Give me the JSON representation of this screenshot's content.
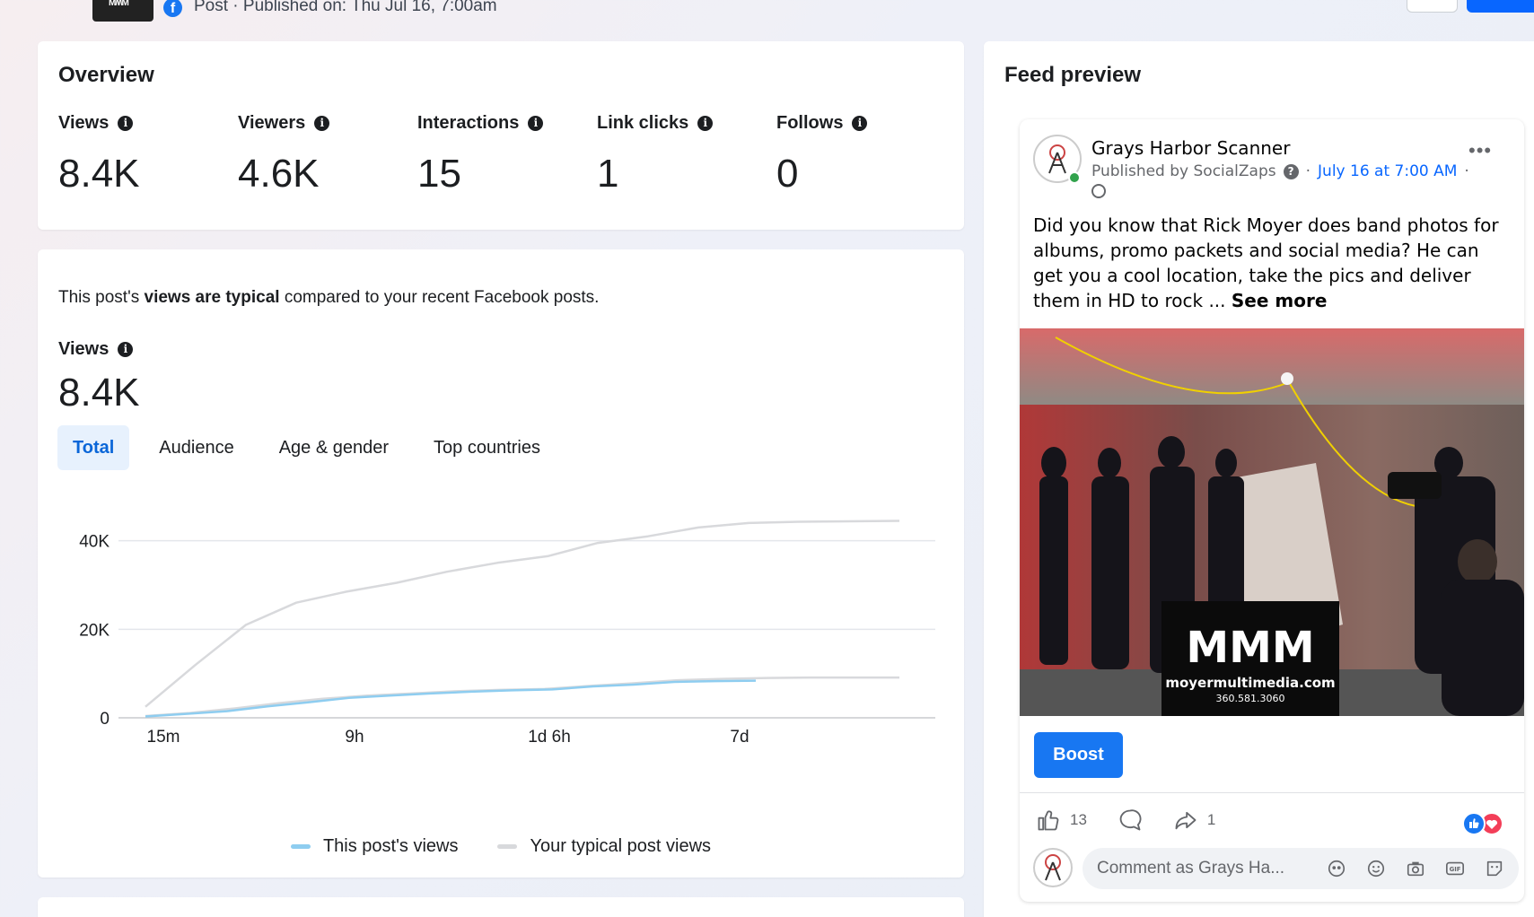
{
  "header": {
    "post_meta": "Post · Published on: Thu Jul 16, 7:00am",
    "fb_icon": "f"
  },
  "overview": {
    "title": "Overview",
    "metrics": [
      {
        "label": "Views",
        "value": "8.4K"
      },
      {
        "label": "Viewers",
        "value": "4.6K"
      },
      {
        "label": "Interactions",
        "value": "15"
      },
      {
        "label": "Link clicks",
        "value": "1"
      },
      {
        "label": "Follows",
        "value": "0"
      }
    ]
  },
  "views_section": {
    "typical_pre": "This post's ",
    "typical_bold": "views are typical",
    "typical_post": " compared to your recent Facebook posts.",
    "views_label": "Views",
    "views_value": "8.4K",
    "tabs": [
      "Total",
      "Audience",
      "Age & gender",
      "Top countries"
    ],
    "active_tab": "Total"
  },
  "chart_data": {
    "type": "line",
    "x_tick_labels": [
      "15m",
      "9h",
      "1d 6h",
      "7d"
    ],
    "y_tick_labels": [
      "0",
      "20K",
      "40K"
    ],
    "ylim": [
      0,
      45000
    ],
    "grid": true,
    "legend_position": "bottom",
    "series": [
      {
        "name": "This post's views",
        "color": "#8ecdf0",
        "values": [
          300,
          900,
          1500,
          2600,
          3500,
          4500,
          5000,
          5500,
          5900,
          6200,
          6400,
          7100,
          7500,
          8100,
          8300,
          8400
        ]
      },
      {
        "name": "Your typical post views",
        "color": "#d8d9dc",
        "values": [
          2500,
          12000,
          21000,
          26000,
          28500,
          30500,
          33000,
          35000,
          36500,
          39500,
          41000,
          43000,
          44000,
          44300,
          44400,
          44500
        ]
      },
      {
        "name": "Your typical post views (low)",
        "color": "#d8d9dc",
        "values": [
          400,
          1100,
          2100,
          3300,
          4300,
          5000,
          5500,
          6000,
          6300,
          6500,
          7200,
          7800,
          8500,
          8800,
          9000,
          9100,
          9100,
          9100
        ]
      }
    ]
  },
  "feed_preview": {
    "title": "Feed preview",
    "page_name": "Grays Harbor Scanner",
    "published_by": "Published by SocialZaps",
    "date_link": "July 16 at 7:00 AM",
    "dot_sep": "·",
    "post_text": "Did you know that Rick Moyer does band photos for albums, promo packets and social media?  He can get you a cool location, take the pics and deliver them in HD to rock ... ",
    "see_more": "See more",
    "photo_logo": "MMM",
    "photo_domain": "moyermultimedia.com",
    "photo_phone": "360.581.3060",
    "boost_label": "Boost",
    "like_count": "13",
    "share_count": "1",
    "comment_placeholder": "Comment as Grays Ha..."
  }
}
